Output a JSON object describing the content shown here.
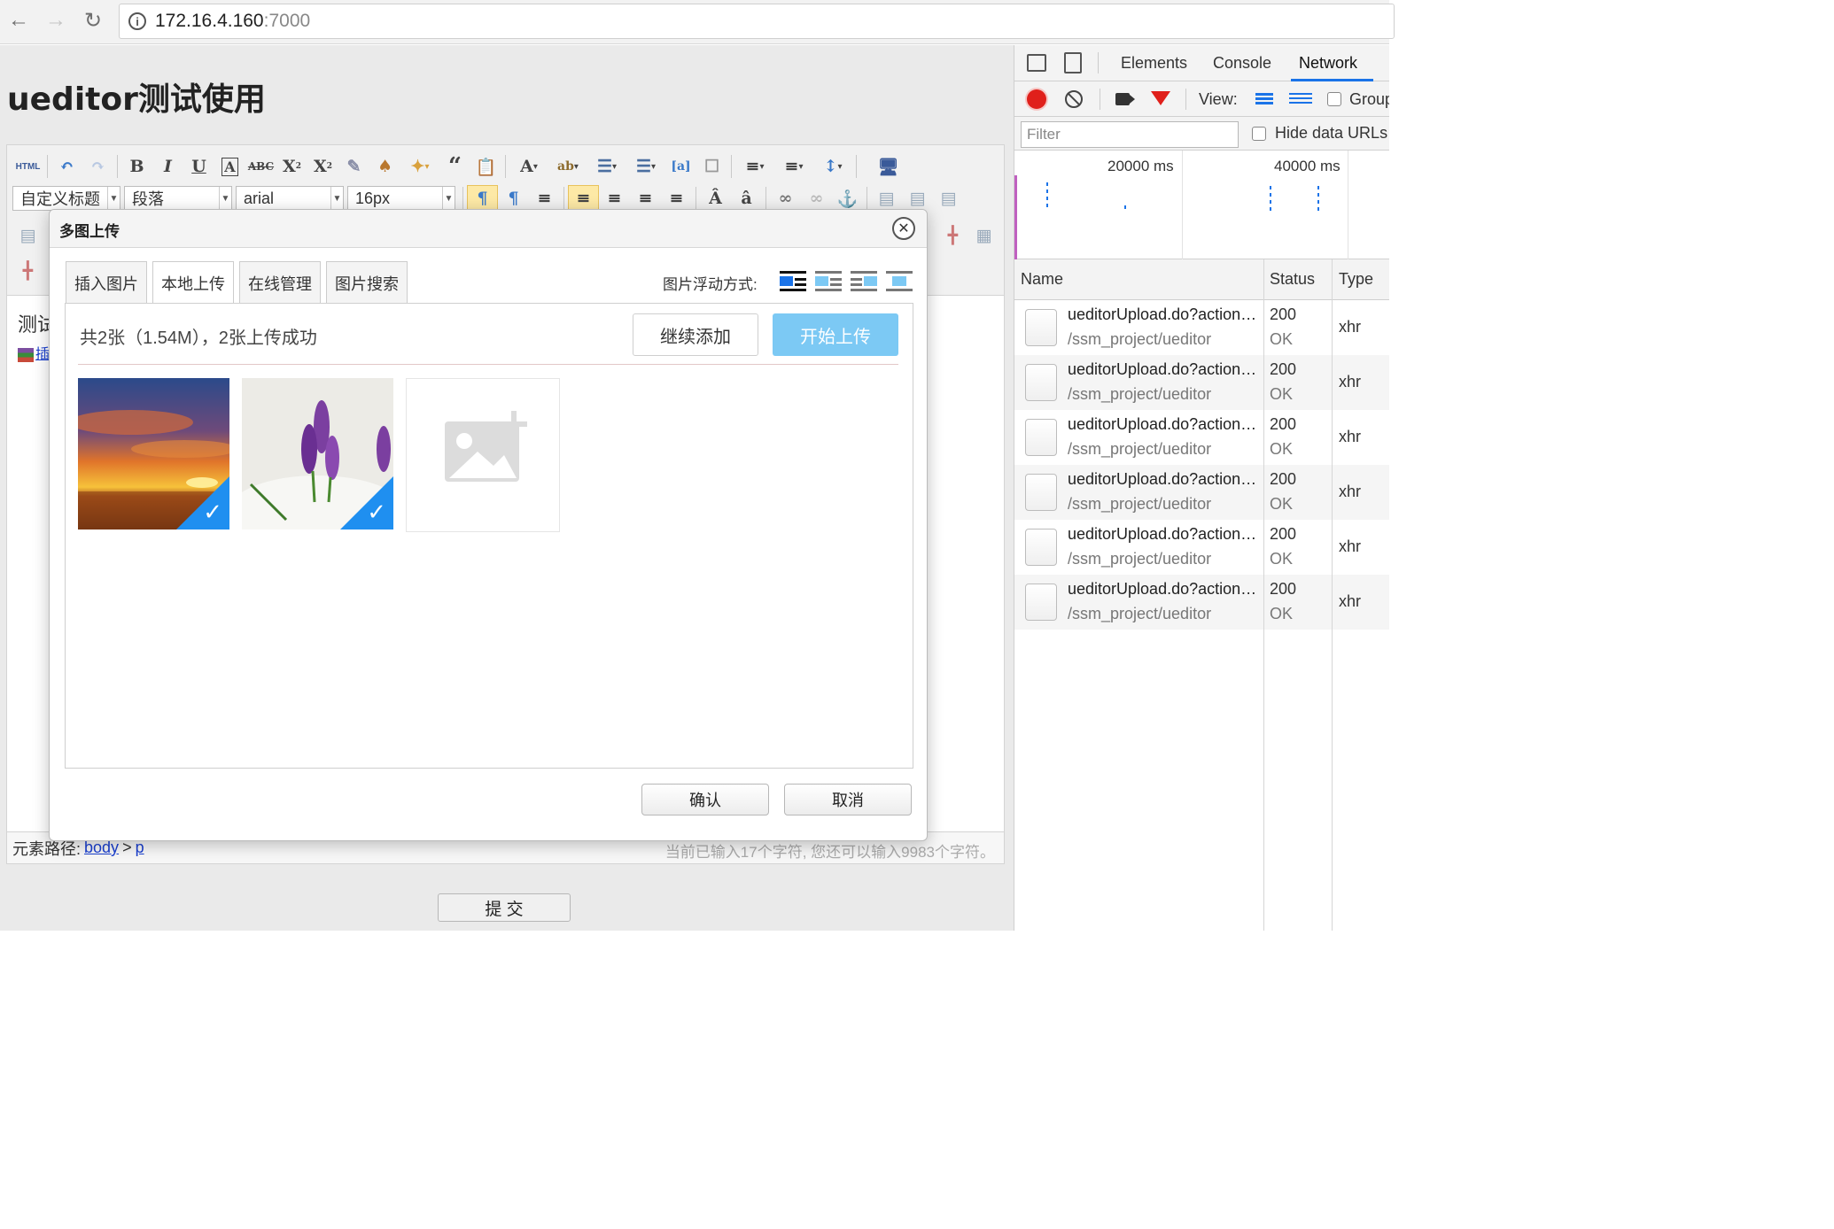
{
  "browser": {
    "url_host": "172.16.4.160",
    "url_port": ":7000"
  },
  "page": {
    "title": "ueditor测试使用",
    "editor": {
      "toolbar": {
        "html_label": "HTML",
        "heading_select": "自定义标题",
        "paragraph_select": "段落",
        "font_select": "arial",
        "size_select": "16px"
      },
      "body_text": "测试",
      "body_link": "插",
      "statusbar": {
        "path_label": "元素路径:",
        "path_body": "body",
        "path_sep": ">",
        "path_p": "p",
        "word_count": "当前已输入17个字符, 您还可以输入9983个字符。"
      }
    },
    "submit_label": "提 交"
  },
  "modal": {
    "title": "多图上传",
    "tabs": [
      "插入图片",
      "本地上传",
      "在线管理",
      "图片搜索"
    ],
    "active_tab": "本地上传",
    "float_label": "图片浮动方式:",
    "summary": "共2张（1.54M），2张上传成功",
    "add_button": "继续添加",
    "start_button": "开始上传",
    "confirm_button": "确认",
    "cancel_button": "取消",
    "images": [
      {
        "name": "sunset",
        "uploaded": true
      },
      {
        "name": "crocus",
        "uploaded": true
      }
    ]
  },
  "devtools": {
    "tabs": [
      "Elements",
      "Console",
      "Network"
    ],
    "active_tab": "Network",
    "view_label": "View:",
    "group_label": "Group",
    "filter_placeholder": "Filter",
    "hide_data_urls_label": "Hide data URLs",
    "timeline_labels": [
      "20000 ms",
      "40000 ms"
    ],
    "columns": {
      "name": "Name",
      "status": "Status",
      "type": "Type"
    },
    "requests": [
      {
        "name": "ueditorUpload.do?action=uploadimage",
        "path": "/ssm_project/ueditor",
        "status": "200",
        "status_text": "OK",
        "type": "xhr"
      },
      {
        "name": "ueditorUpload.do?action=uploadimage",
        "path": "/ssm_project/ueditor",
        "status": "200",
        "status_text": "OK",
        "type": "xhr"
      },
      {
        "name": "ueditorUpload.do?action=uploadimage",
        "path": "/ssm_project/ueditor",
        "status": "200",
        "status_text": "OK",
        "type": "xhr"
      },
      {
        "name": "ueditorUpload.do?action=uploadimage",
        "path": "/ssm_project/ueditor",
        "status": "200",
        "status_text": "OK",
        "type": "xhr"
      },
      {
        "name": "ueditorUpload.do?action=uploadimage",
        "path": "/ssm_project/ueditor",
        "status": "200",
        "status_text": "OK",
        "type": "xhr"
      },
      {
        "name": "ueditorUpload.do?action=uploadimage",
        "path": "/ssm_project/ueditor",
        "status": "200",
        "status_text": "OK",
        "type": "xhr"
      }
    ]
  },
  "colors": {
    "accent": "#1a73e8",
    "upload_check": "#1f8ff0",
    "start_button": "#7cc9f4",
    "record": "#e0201b"
  }
}
